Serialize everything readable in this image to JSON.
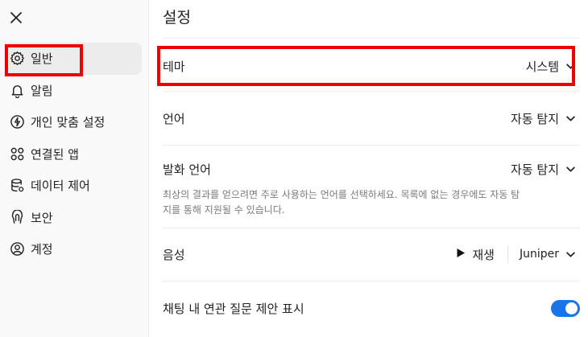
{
  "sidebar": {
    "close_label": "close",
    "items": [
      {
        "label": "일반",
        "icon": "gear-icon",
        "active": true
      },
      {
        "label": "알림",
        "icon": "bell-icon",
        "active": false
      },
      {
        "label": "개인 맞춤 설정",
        "icon": "personalization-icon",
        "active": false
      },
      {
        "label": "연결된 앱",
        "icon": "connected-apps-icon",
        "active": false
      },
      {
        "label": "데이터 제어",
        "icon": "database-icon",
        "active": false
      },
      {
        "label": "보안",
        "icon": "security-icon",
        "active": false
      },
      {
        "label": "계정",
        "icon": "account-icon",
        "active": false
      }
    ]
  },
  "main": {
    "title": "설정",
    "theme": {
      "label": "테마",
      "value": "시스템"
    },
    "language": {
      "label": "언어",
      "value": "자동 탐지"
    },
    "spoken_language": {
      "label": "발화 언어",
      "value": "자동 탐지",
      "description": "최상의 결과를 얻으려면 주로 사용하는 언어를 선택하세요. 목록에 없는 경우에도 자동 탐지를 통해 지원될 수 있습니다."
    },
    "voice": {
      "label": "음성",
      "play_label": "재생",
      "value": "Juniper"
    },
    "follow_up": {
      "label": "채팅 내 연관 질문 제안 표시",
      "enabled": true
    }
  },
  "colors": {
    "annotation": "#ee0000",
    "toggle_on": "#1a73e8",
    "sidebar_bg": "#f9f9f9"
  }
}
